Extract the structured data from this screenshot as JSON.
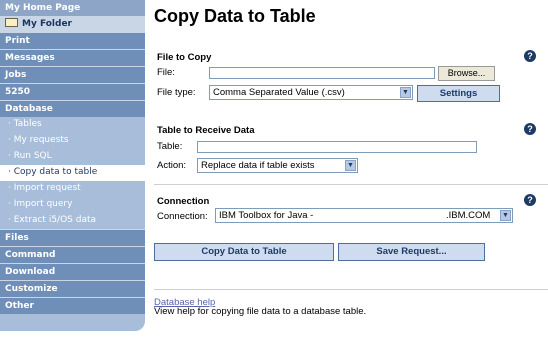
{
  "sidebar": {
    "home": "My Home Page",
    "folder": "My Folder",
    "items": [
      "Print",
      "Messages",
      "Jobs",
      "5250",
      "Database"
    ],
    "database_sub": [
      "· Tables",
      "· My requests",
      "· Run SQL",
      "· Copy data to table",
      "· Import request",
      "· Import query",
      "· Extract i5/OS data"
    ],
    "bottom_items": [
      "Files",
      "Command",
      "Download",
      "Customize",
      "Other"
    ]
  },
  "page": {
    "title": "Copy Data to Table",
    "file_to_copy": {
      "heading": "File to Copy",
      "file_label": "File:",
      "file_value": "",
      "browse": "Browse...",
      "type_label": "File type:",
      "type_value": "Comma Separated Value (.csv)",
      "settings": "Settings"
    },
    "table_to_receive": {
      "heading": "Table to Receive Data",
      "table_label": "Table:",
      "table_value": "",
      "action_label": "Action:",
      "action_value": "Replace data if table exists"
    },
    "connection": {
      "heading": "Connection",
      "label": "Connection:",
      "value": "IBM Toolbox for Java -",
      "value_suffix": ".IBM.COM"
    },
    "buttons": {
      "copy": "Copy Data to Table",
      "save": "Save Request..."
    },
    "help_link": "Database help",
    "help_desc": "View help for copying file data to a database table.",
    "help_icon": "?"
  }
}
